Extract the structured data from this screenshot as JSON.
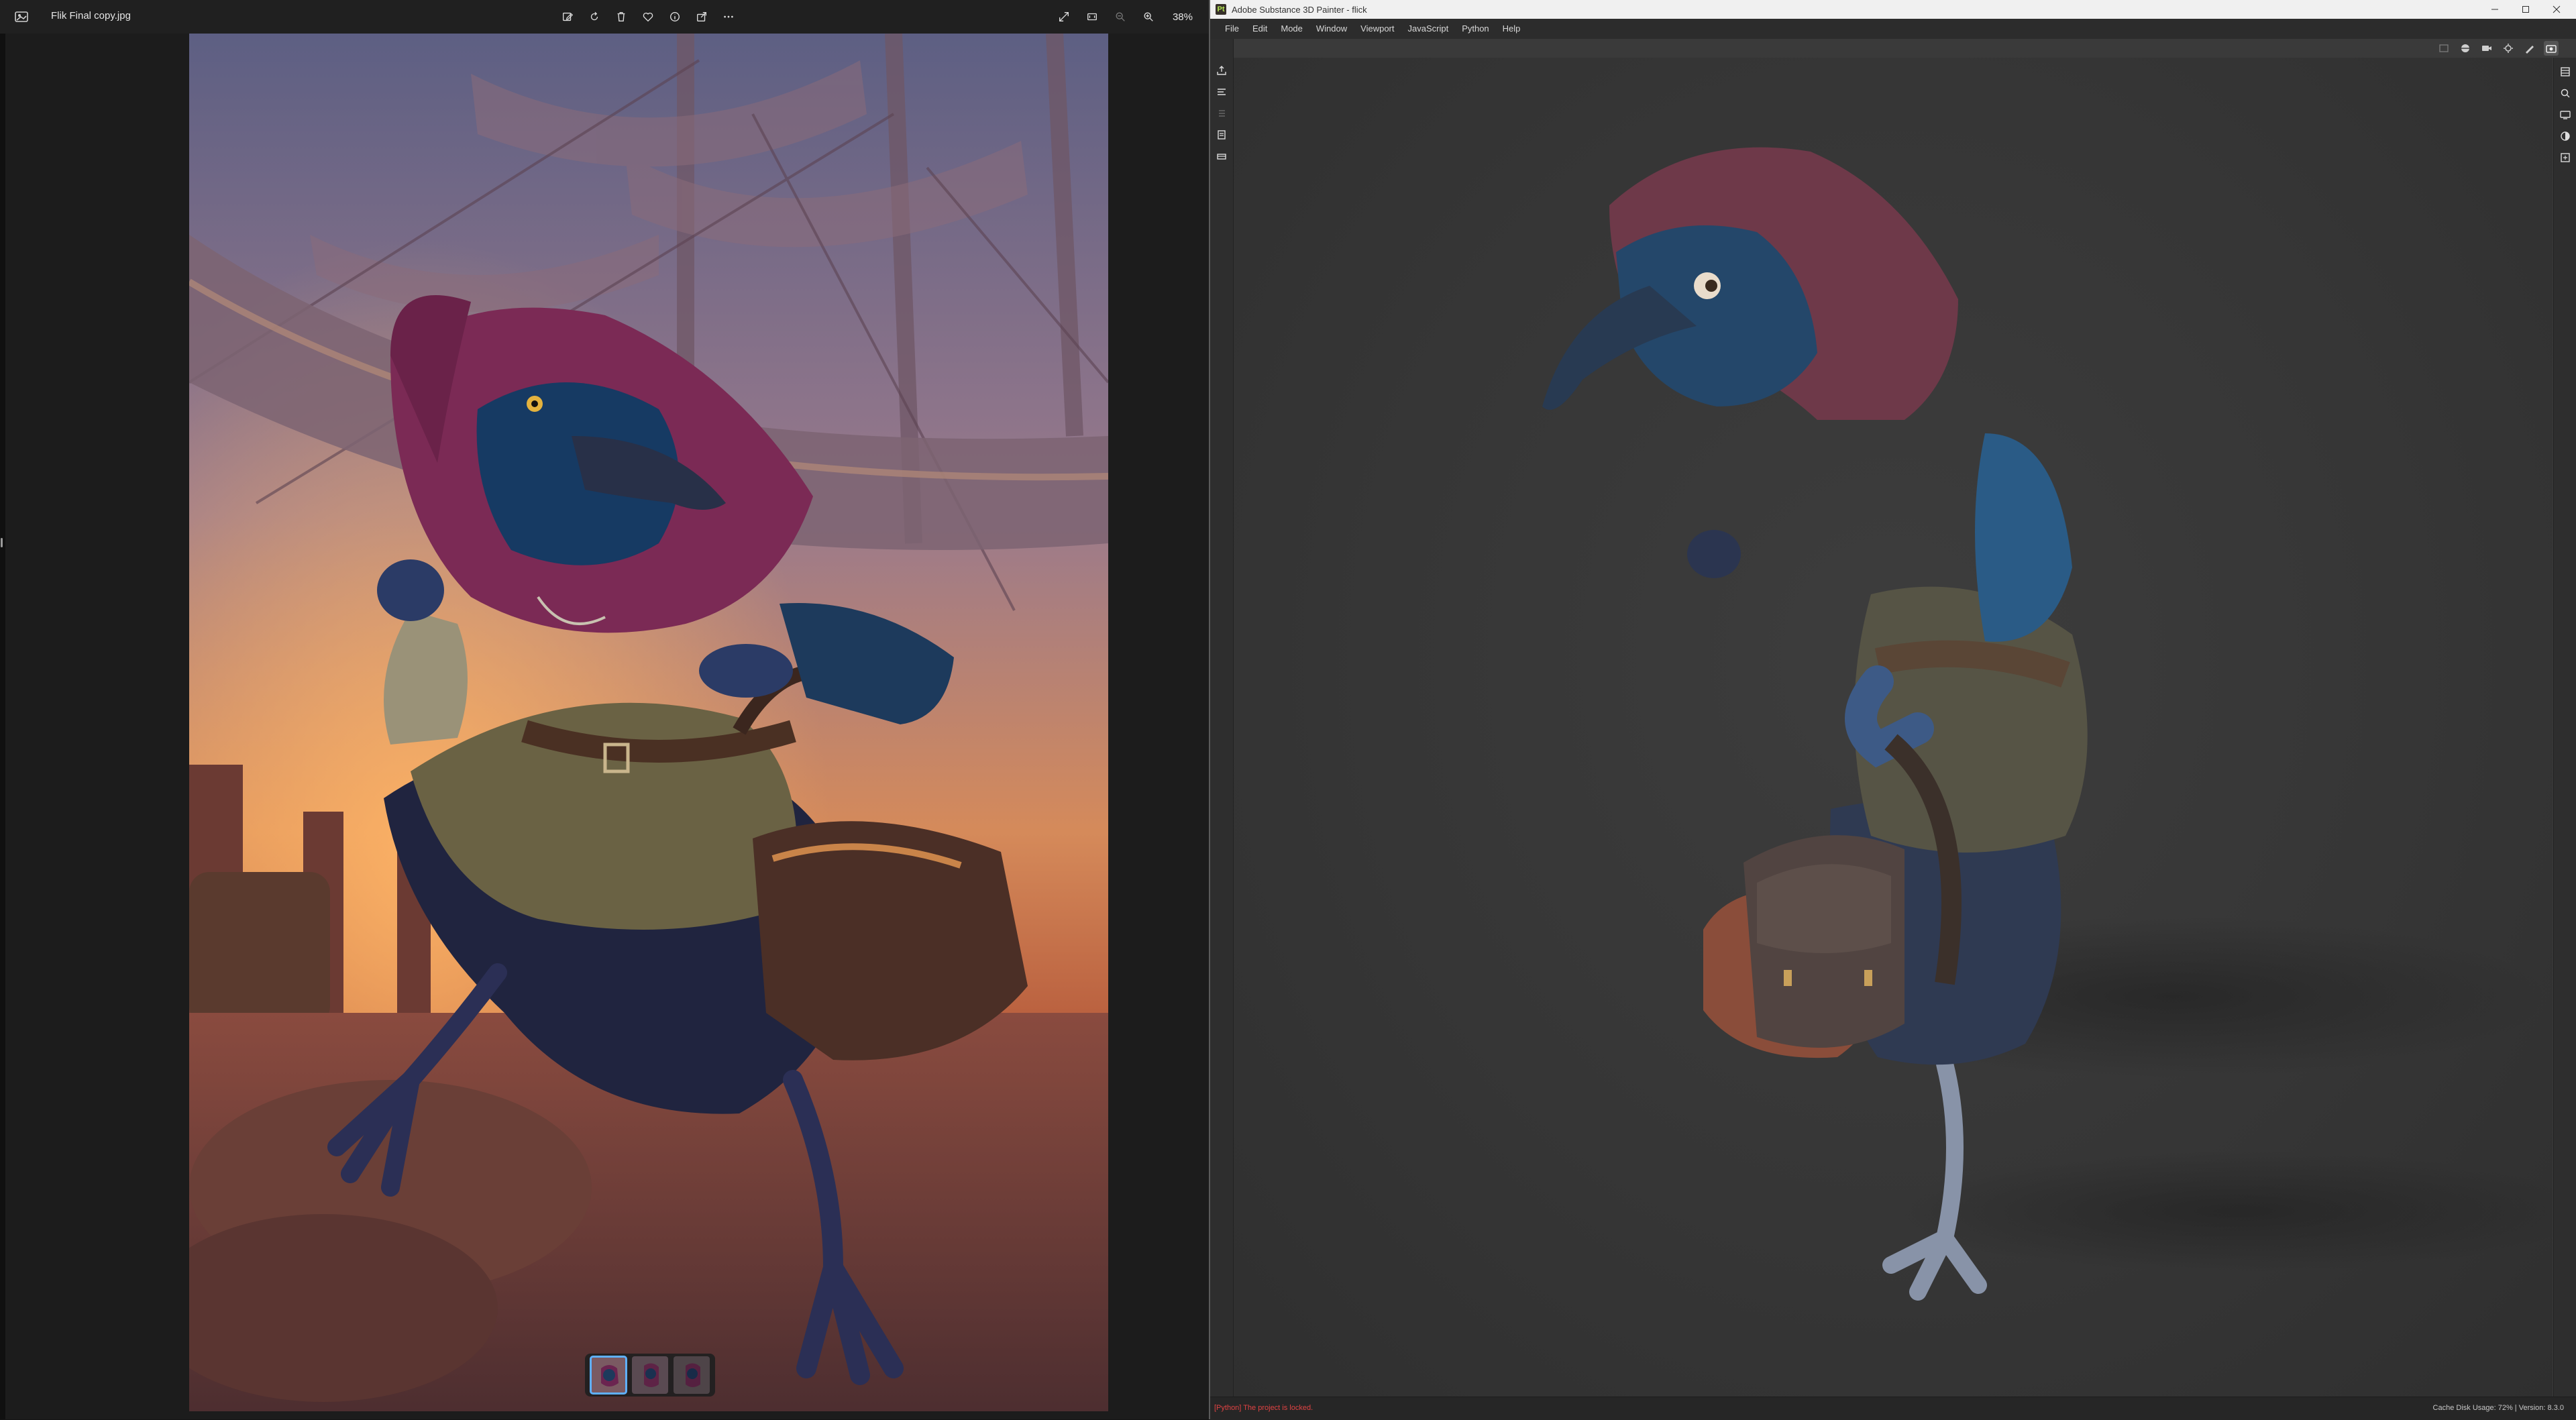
{
  "photo_viewer": {
    "file_name": "Flik Final copy.jpg",
    "zoom": "38%",
    "toolbar_icons": [
      "edit-icon",
      "rotate-icon",
      "delete-icon",
      "favorite-icon",
      "info-icon",
      "share-icon",
      "more-icon"
    ],
    "right_icons": [
      "fullscreen-icon",
      "fit-icon",
      "zoom-out-icon",
      "zoom-in-icon"
    ],
    "thumbnails": 3,
    "active_thumbnail": 1
  },
  "painter": {
    "title": "Adobe Substance 3D Painter - flick",
    "logo_text": "Pt",
    "menu": [
      "File",
      "Edit",
      "Mode",
      "Window",
      "Viewport",
      "JavaScript",
      "Python",
      "Help"
    ],
    "status_message": "[Python] The project is locked.",
    "status_right": "Cache Disk Usage:   72% | Version: 8.3.0",
    "colors": {
      "accent": "#b5e853",
      "error": "#e04343",
      "viewport_bg": "#3a3a3a"
    }
  }
}
